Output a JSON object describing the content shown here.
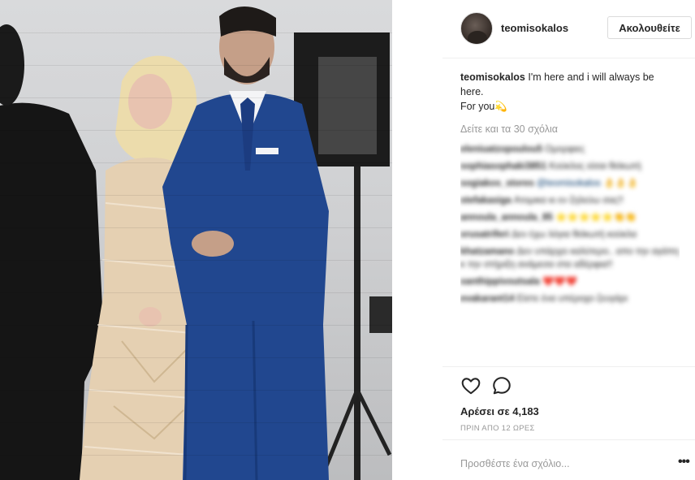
{
  "post": {
    "username": "teomisokalos",
    "follow_label": "Ακολουθείτε",
    "caption_user": "teomisokalos",
    "caption_text": "I'm here and i will always be here.",
    "caption_line2": "For you",
    "caption_emoji": "💫",
    "view_all_label": "Δείτε και τα 30 σχόλια",
    "comments": [
      {
        "user": "eleniuatzopoulou5",
        "text": "Ομορφιες"
      },
      {
        "user": "sophiasophaki3851",
        "text": "Κούκλος είσαι θεϊκωτή"
      },
      {
        "user": "sogiakos_stores",
        "text": "@teomisokalos 👌👌👌"
      },
      {
        "user": "stefakasiga",
        "text": "Ατομικα κι εν ζηλεύω σας!!"
      },
      {
        "user": "annoula_annoula_85",
        "text": "⭐⭐⭐⭐⭐👏👏"
      },
      {
        "user": "xrusatriferi",
        "text": "Δεν έχω λόγια θεϊκωτή κούκλα"
      },
      {
        "user": "khatzamano",
        "text": "Δεν υπάρχει καλύτερο.. απο την αγάπη κ την στήριξη ανάμεσα στα αδέρφια!!"
      },
      {
        "user": "xanthippivoutsala",
        "text": "❤️❤️❤️"
      },
      {
        "user": "evakarant14",
        "text": "Είστε ένα υπέροχο ζευγάρι"
      }
    ],
    "likes_label": "Αρέσει σε 4,183",
    "time_label": "ΠΡΙΝ ΑΠΟ 12 ΩΡΕΣ",
    "add_comment_placeholder": "Προσθέστε ένα σχόλιο...",
    "more_label": "•••"
  },
  "colors": {
    "text": "#262626",
    "muted": "#999999",
    "border": "#efefef",
    "suit": "#1f4796"
  },
  "icons": [
    "heart-icon",
    "comment-icon",
    "more-options-icon"
  ]
}
